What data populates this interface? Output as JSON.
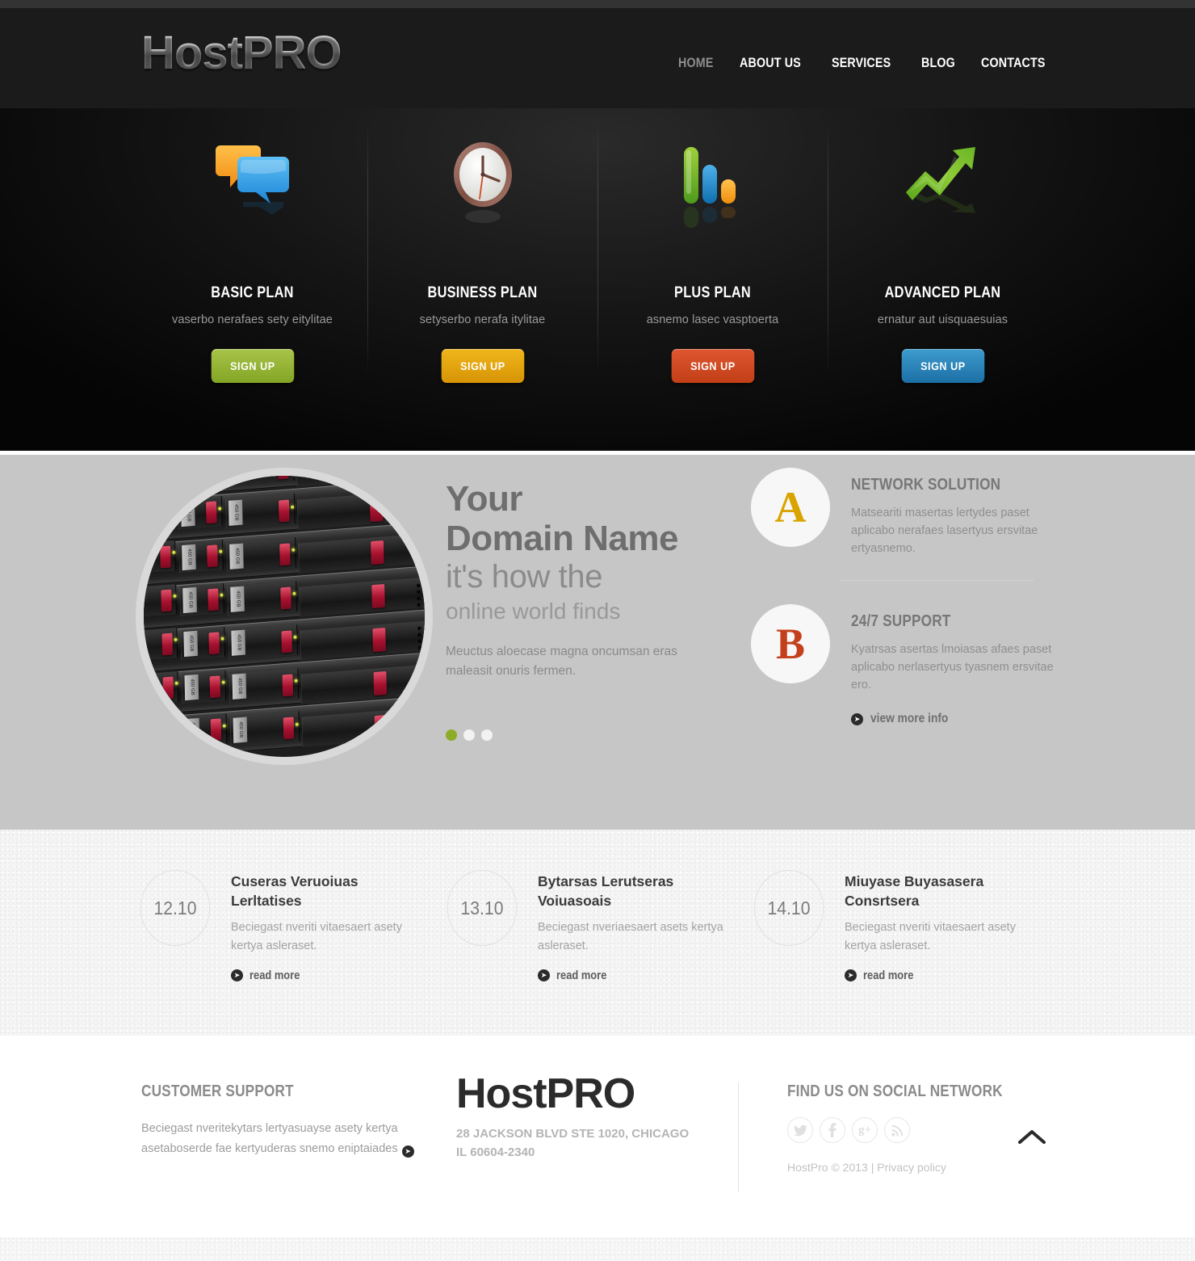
{
  "site": {
    "logo": "HostPRO",
    "footer_logo": "HostPRO"
  },
  "nav": {
    "items": [
      {
        "label": "HOME",
        "active": true
      },
      {
        "label": "ABOUT US",
        "active": false
      },
      {
        "label": "SERVICES",
        "active": false
      },
      {
        "label": "BLOG",
        "active": false
      },
      {
        "label": "CONTACTS",
        "active": false
      }
    ]
  },
  "plans": [
    {
      "icon": "speech-bubbles-icon",
      "title": "BASIC PLAN",
      "subtitle": "vaserbo nerafaes sety eitylitae",
      "button": "SIGN UP",
      "button_color": "#8fae2a"
    },
    {
      "icon": "clock-icon",
      "title": "BUSINESS PLAN",
      "subtitle": "setyserbo nerafa itylitae",
      "button": "SIGN UP",
      "button_color": "#e0a50e"
    },
    {
      "icon": "bar-chart-icon",
      "title": "PLUS PLAN",
      "subtitle": "asnemo lasec vasptoerta",
      "button": "SIGN UP",
      "button_color": "#cf4620"
    },
    {
      "icon": "growth-arrow-icon",
      "title": "ADVANCED PLAN",
      "subtitle": "ernatur aut uisquaesuias",
      "button": "SIGN UP",
      "button_color": "#2a80b5"
    }
  ],
  "hero": {
    "image_alt": "server-rack-photo",
    "drive_label": "450 GB",
    "heading_line1": "Your",
    "heading_line2": "Domain Name",
    "heading_line3": "it's how the",
    "heading_line4": "online world finds",
    "paragraph": "Meuctus aloecase magna oncumsan eras maleasit onuris fermen.",
    "slider_dots": [
      {
        "active": true
      },
      {
        "active": false
      },
      {
        "active": false
      }
    ],
    "features": [
      {
        "badge": "A",
        "badge_color": "#d9a400",
        "title": "NETWORK SOLUTION",
        "text": "Matseariti masertas lertydes paset aplicabo nerafaes lasertyus ersvitae ertyasnemo."
      },
      {
        "badge": "B",
        "badge_color": "#c4401c",
        "title": "24/7 SUPPORT",
        "text": "Kyatrsas asertas lmoiasas afaes paset aplicabo nerlasertyus tyasnem ersvitae ero."
      }
    ],
    "view_more_label": "view more info"
  },
  "news": {
    "items": [
      {
        "date": "12.10",
        "title": "Cuseras Veruoiuas Lerltatises",
        "text": "Beciegast nveriti vitaesaert asety kertya asleraset.",
        "link": "read more"
      },
      {
        "date": "13.10",
        "title": "Bytarsas Lerutseras Voiuasoais",
        "text": "Beciegast nveriaesaert asets kertya asleraset.",
        "link": "read more"
      },
      {
        "date": "14.10",
        "title": "Miuyase Buyasasera Consrtsera",
        "text": "Beciegast nveriti vitaesaert asety kertya asleraset.",
        "link": "read more"
      }
    ]
  },
  "footer": {
    "support_title": "CUSTOMER SUPPORT",
    "support_text": "Beciegast nveritekytars lertyasuayse asety kertya asetaboserde fae kertyuderas snemo eniptaiades",
    "address_line1": "28 JACKSON BLVD STE 1020, CHICAGO",
    "address_line2": "IL 60604-2340",
    "social_title": "FIND US ON SOCIAL NETWORK",
    "socials": [
      {
        "name": "twitter-icon"
      },
      {
        "name": "facebook-icon"
      },
      {
        "name": "google-plus-icon"
      },
      {
        "name": "rss-icon"
      }
    ],
    "copyright": "HostPro © 2013",
    "separator": "|",
    "privacy": "Privacy policy",
    "back_to_top": "back-to-top-icon"
  }
}
